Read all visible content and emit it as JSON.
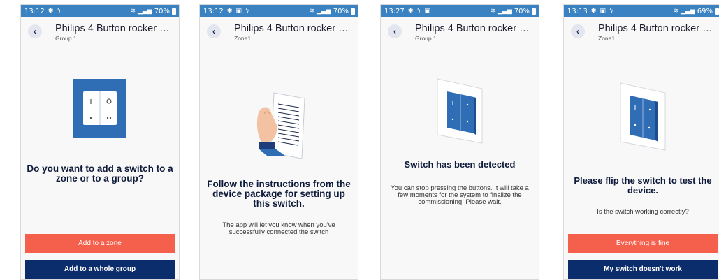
{
  "colors": {
    "status_bar": "#3a82c1",
    "primary_button": "#f5604c",
    "secondary_button": "#0c2d6b",
    "switch_blue": "#2f6db5"
  },
  "screens": [
    {
      "status": {
        "time": "13:12",
        "battery": "70%"
      },
      "header": {
        "title": "Philips 4 Button rocker UI...",
        "subtitle": "Group 1"
      },
      "headline": "Do you want to add a switch to a zone or to a group?",
      "body": "",
      "primary_button": "Add to a zone",
      "secondary_button": "Add to a whole group"
    },
    {
      "status": {
        "time": "13:12",
        "battery": "70%"
      },
      "header": {
        "title": "Philips 4 Button rocker UI...",
        "subtitle": "Zone1"
      },
      "headline": "Follow the instructions from the device package for setting up this switch.",
      "body": "The app will let you know when you've successfully connected the switch"
    },
    {
      "status": {
        "time": "13:27",
        "battery": "70%"
      },
      "header": {
        "title": "Philips 4 Button rocker UI...",
        "subtitle": "Group 1"
      },
      "headline": "Switch has been detected",
      "body": "You can stop pressing the buttons. It will take a few moments for the system to finalize the commissioning. Please wait."
    },
    {
      "status": {
        "time": "13:13",
        "battery": "69%"
      },
      "header": {
        "title": "Philips 4 Button rocker UI...",
        "subtitle": "Zone1"
      },
      "headline": "Please flip the switch to test the device.",
      "body": "Is the switch working correctly?",
      "primary_button": "Everything is fine",
      "secondary_button": "My switch doesn't work"
    }
  ]
}
